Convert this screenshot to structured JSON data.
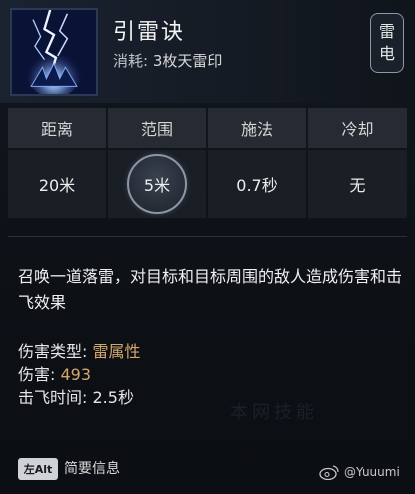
{
  "skill": {
    "name": "引雷诀",
    "cost_label": "消耗:",
    "cost_value": "3枚天雷印",
    "element_chars": [
      "雷",
      "电"
    ],
    "icon": "lightning-skill-icon"
  },
  "stats": {
    "headers": [
      "距离",
      "范围",
      "施法",
      "冷却"
    ],
    "values": [
      "20米",
      "5米",
      "0.7秒",
      "无"
    ]
  },
  "description": "召唤一道落雷，对目标和目标周围的敌人造成伤害和击飞效果",
  "attributes": {
    "type_label": "伤害类型:",
    "type_value": "雷属性",
    "damage_label": "伤害:",
    "damage_value": "493",
    "knockup_label": "击飞时间:",
    "knockup_value": "2.5秒"
  },
  "watermark": "本网技能",
  "footer": {
    "key": "左Alt",
    "action": "简要信息",
    "credit": "@Yuuumi"
  },
  "colors": {
    "accent_value": "#d4a76a",
    "stat_header_bg": "#262b33",
    "stat_value_bg": "#1a1e25"
  }
}
